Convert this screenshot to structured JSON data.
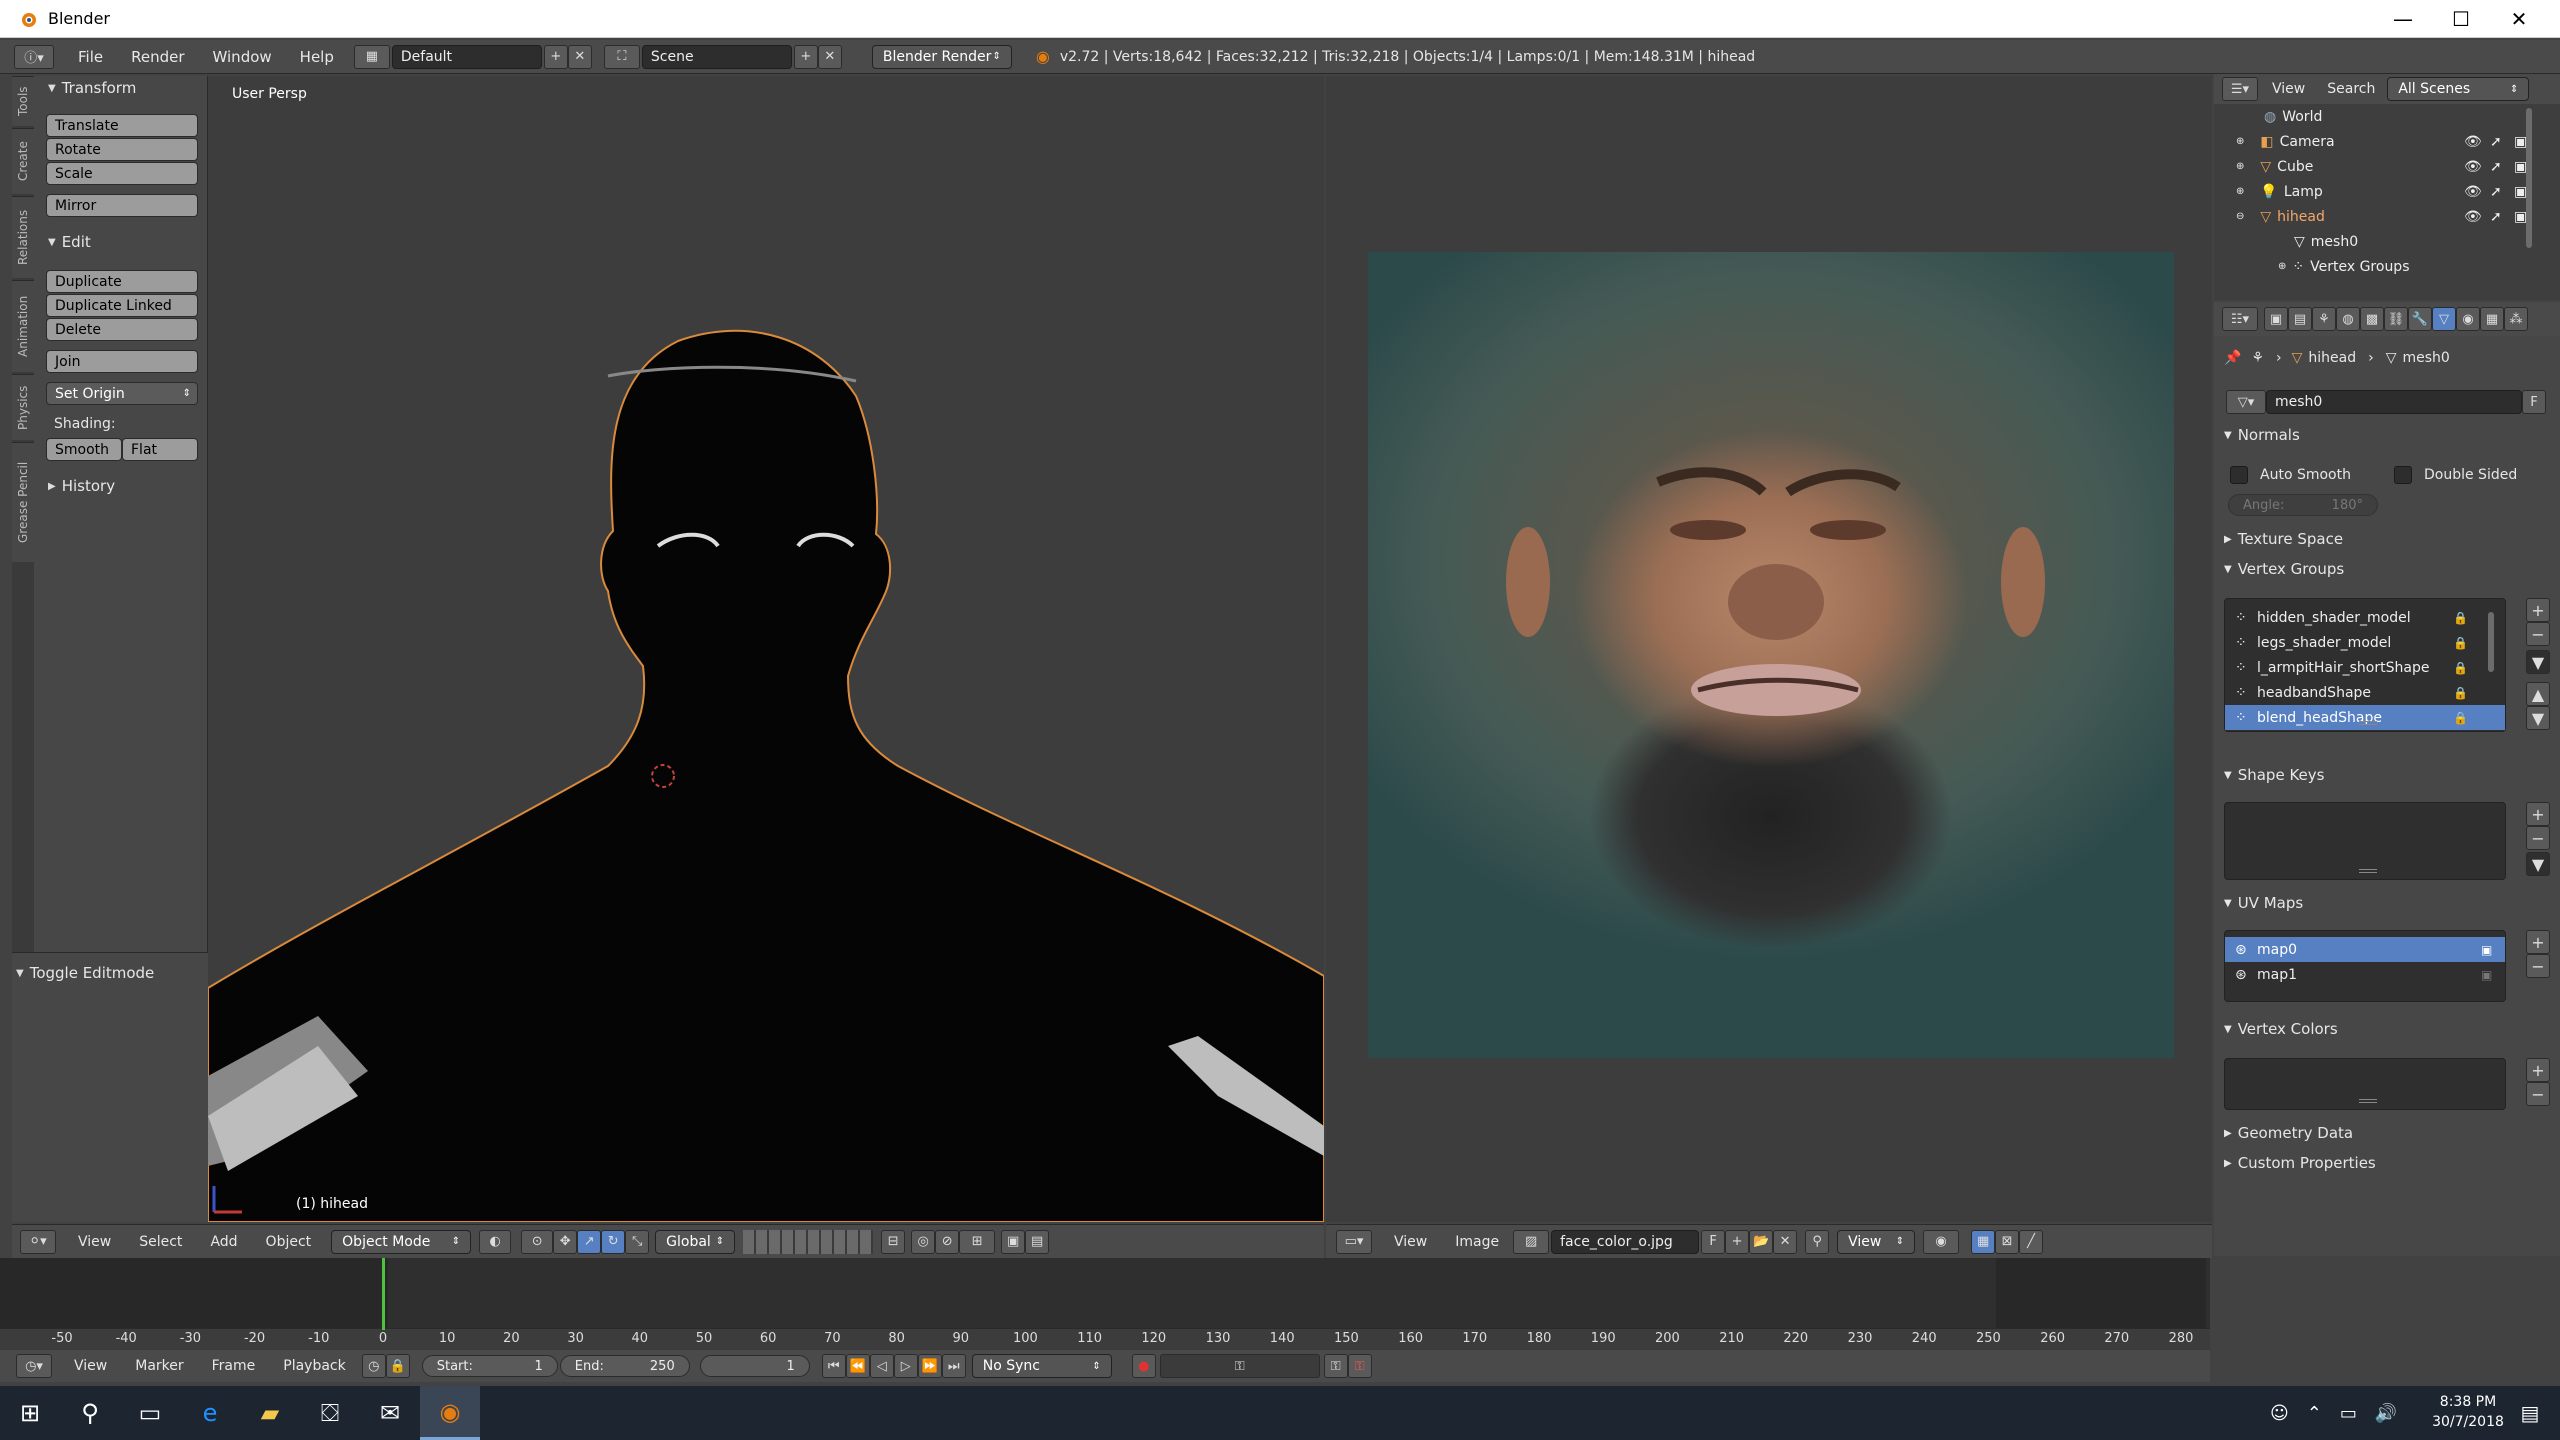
{
  "app": {
    "title": "Blender",
    "window_controls": {
      "minimize": "—",
      "maximize": "☐",
      "close": "✕"
    }
  },
  "infobar": {
    "menus": [
      "File",
      "Render",
      "Window",
      "Help"
    ],
    "layout": "Default",
    "scene": "Scene",
    "engine": "Blender Render",
    "stats": "v2.72 | Verts:18,642 | Faces:32,212 | Tris:32,218 | Objects:1/4 | Lamps:0/1 | Mem:148.31M | hihead"
  },
  "shelf_tabs": [
    "Tools",
    "Create",
    "Relations",
    "Animation",
    "Physics",
    "Grease Pencil"
  ],
  "tool_shelf": {
    "transform_header": "Transform",
    "transform_buttons": [
      "Translate",
      "Rotate",
      "Scale"
    ],
    "mirror": "Mirror",
    "edit_header": "Edit",
    "edit_buttons": [
      "Duplicate",
      "Duplicate Linked",
      "Delete"
    ],
    "join": "Join",
    "set_origin": "Set Origin",
    "shading_label": "Shading:",
    "smooth": "Smooth",
    "flat": "Flat",
    "history_header": "History",
    "toggle_editmode": "Toggle Editmode"
  },
  "viewport": {
    "label": "User Persp",
    "object_label": "(1) hihead",
    "menus": [
      "View",
      "Select",
      "Add",
      "Object"
    ],
    "mode": "Object Mode",
    "orientation": "Global"
  },
  "image_editor": {
    "menus": [
      "View",
      "Image"
    ],
    "image_name": "face_color_o.jpg",
    "fake_user": "F",
    "view_select": "View"
  },
  "outliner": {
    "menus": [
      "View",
      "Search"
    ],
    "scene_filter": "All Scenes",
    "items": [
      {
        "label": "World",
        "indent": 0
      },
      {
        "label": "Camera",
        "indent": 0
      },
      {
        "label": "Cube",
        "indent": 0
      },
      {
        "label": "Lamp",
        "indent": 0
      },
      {
        "label": "hihead",
        "indent": 0,
        "highlight": true
      },
      {
        "label": "mesh0",
        "indent": 1
      },
      {
        "label": "Vertex Groups",
        "indent": 1
      }
    ]
  },
  "properties": {
    "breadcrumb_object": "hihead",
    "breadcrumb_mesh": "mesh0",
    "datablock": "mesh0",
    "datablock_fake": "F",
    "normals_header": "Normals",
    "auto_smooth": "Auto Smooth",
    "double_sided": "Double Sided",
    "angle": "Angle:",
    "angle_value": "180°",
    "texture_space": "Texture Space",
    "vertex_groups_header": "Vertex Groups",
    "vertex_groups": [
      {
        "name": "hidden_shader_model",
        "selected": false
      },
      {
        "name": "legs_shader_model",
        "selected": false
      },
      {
        "name": "l_armpitHair_shortShape",
        "selected": false
      },
      {
        "name": "headbandShape",
        "selected": false
      },
      {
        "name": "blend_headShape",
        "selected": true
      }
    ],
    "shape_keys_header": "Shape Keys",
    "uv_maps_header": "UV Maps",
    "uv_maps": [
      {
        "name": "map0",
        "selected": true
      },
      {
        "name": "map1",
        "selected": false
      }
    ],
    "vertex_colors_header": "Vertex Colors",
    "geometry_data": "Geometry Data",
    "custom_properties": "Custom Properties"
  },
  "timeline": {
    "ticks": [
      "-50",
      "-40",
      "-30",
      "-20",
      "-10",
      "0",
      "10",
      "20",
      "30",
      "40",
      "50",
      "60",
      "70",
      "80",
      "90",
      "100",
      "110",
      "120",
      "130",
      "140",
      "150",
      "160",
      "170",
      "180",
      "190",
      "200",
      "210",
      "220",
      "230",
      "240",
      "250",
      "260",
      "270",
      "280"
    ],
    "menus": [
      "View",
      "Marker",
      "Frame",
      "Playback"
    ],
    "start_label": "Start:",
    "start_value": "1",
    "end_label": "End:",
    "end_value": "250",
    "current_frame": "1",
    "sync": "No Sync",
    "current_frame_number": 0
  },
  "taskbar": {
    "time": "8:38 PM",
    "date": "30/7/2018"
  }
}
